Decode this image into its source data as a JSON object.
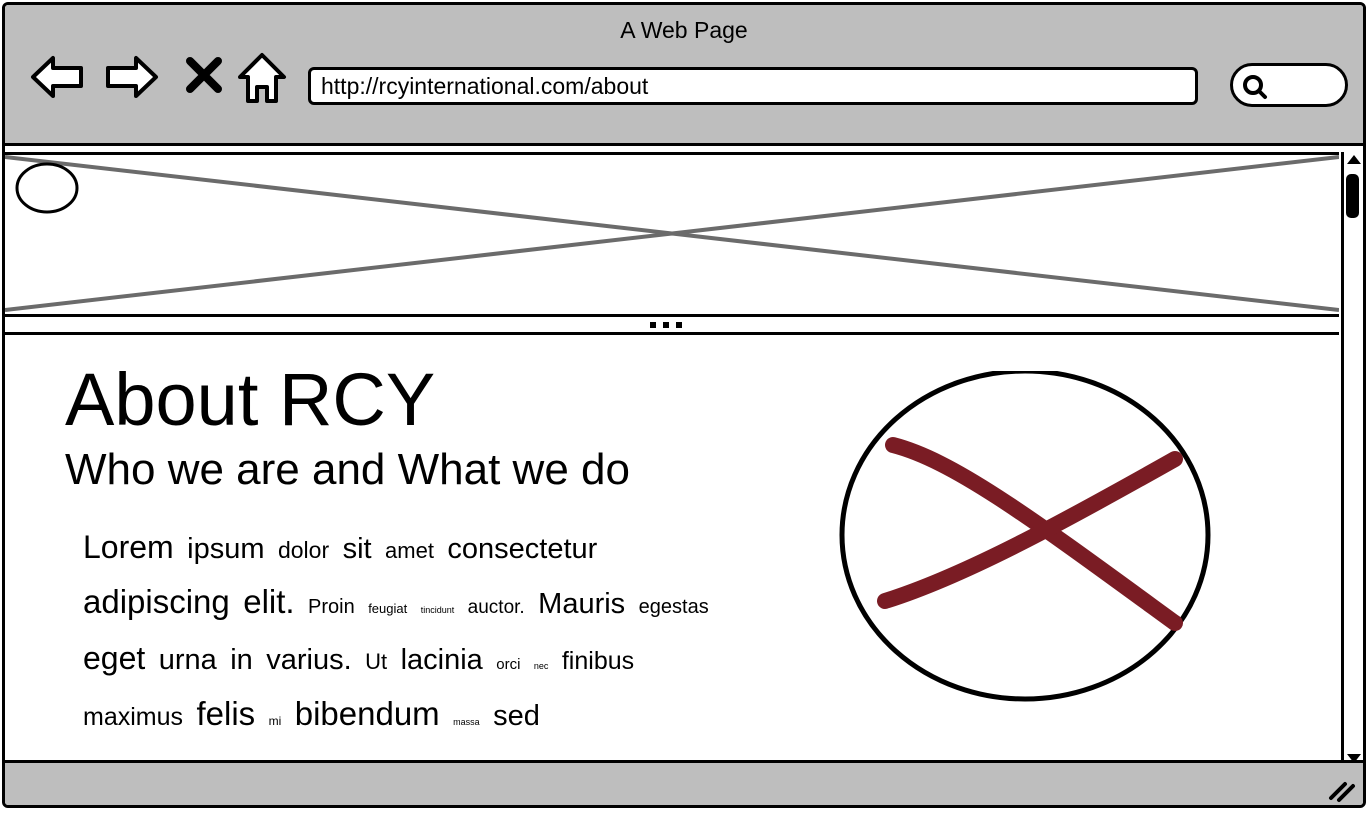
{
  "window": {
    "title": "A Web Page"
  },
  "toolbar": {
    "back_icon": "back-arrow-icon",
    "forward_icon": "forward-arrow-icon",
    "stop_icon": "stop-x-icon",
    "home_icon": "home-icon",
    "url": "http://rcyinternational.com/about",
    "search_icon": "search-icon"
  },
  "banner": {
    "image_placeholder": "image-placeholder",
    "logo_placeholder": "circle-placeholder"
  },
  "content": {
    "title": "About RCY",
    "subtitle": "Who we are and What we do",
    "lorem_words": [
      {
        "t": "Lorem",
        "s": 32
      },
      {
        "t": "ipsum",
        "s": 29
      },
      {
        "t": "dolor",
        "s": 23
      },
      {
        "t": "sit",
        "s": 29
      },
      {
        "t": "amet",
        "s": 22
      },
      {
        "t": "consectetur",
        "s": 29
      },
      {
        "t": "adipiscing",
        "s": 33
      },
      {
        "t": "elit.",
        "s": 33
      },
      {
        "t": "Proin",
        "s": 20
      },
      {
        "t": "feugiat",
        "s": 13
      },
      {
        "t": "tincidunt",
        "s": 9
      },
      {
        "t": "auctor.",
        "s": 19
      },
      {
        "t": "Mauris",
        "s": 29
      },
      {
        "t": "egestas",
        "s": 20
      },
      {
        "t": "eget",
        "s": 32
      },
      {
        "t": "urna",
        "s": 29
      },
      {
        "t": "in",
        "s": 29
      },
      {
        "t": "varius.",
        "s": 29
      },
      {
        "t": "Ut",
        "s": 22
      },
      {
        "t": "lacinia",
        "s": 29
      },
      {
        "t": "orci",
        "s": 15
      },
      {
        "t": "nec",
        "s": 9
      },
      {
        "t": "finibus",
        "s": 25
      },
      {
        "t": "maximus",
        "s": 25
      },
      {
        "t": "felis",
        "s": 33
      },
      {
        "t": "mi",
        "s": 12
      },
      {
        "t": "bibendum",
        "s": 33
      },
      {
        "t": "massa",
        "s": 9
      },
      {
        "t": "sed",
        "s": 29
      }
    ],
    "image_placeholder": "circle-x-image-placeholder",
    "placeholder_color": "#7a1c24"
  },
  "scrollbar": {
    "up_icon": "scroll-up-arrow-icon",
    "down_icon": "scroll-down-arrow-icon"
  },
  "status_bar": {
    "resize_icon": "resize-grip-icon"
  }
}
